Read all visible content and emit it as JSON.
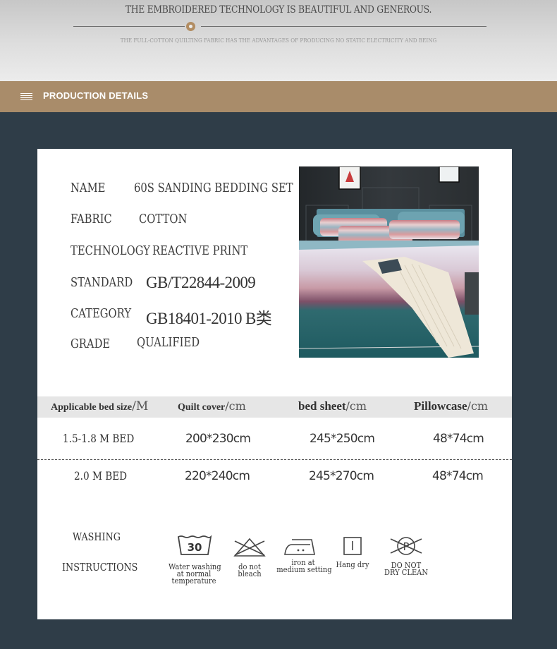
{
  "banner": {
    "title": "THE EMBROIDERED TECHNOLOGY IS BEAUTIFUL AND GENEROUS.",
    "subtitle": "THE FULL-COTTON QUILTING FABRIC HAS THE ADVANTAGES OF PRODUCING NO STATIC ELECTRICITY AND BEING",
    "accent_color": "#b28d62"
  },
  "header": {
    "label": "PRODUCTION DETAILS",
    "icon": "menu-icon",
    "bar_color": "#a98c6a"
  },
  "specs": [
    {
      "label": "NAME",
      "value": "60S SANDING BEDDING SET"
    },
    {
      "label": "FABRIC",
      "value": "COTTON"
    },
    {
      "label": "TECHNOLOGY",
      "value": "REACTIVE PRINT"
    },
    {
      "label": "STANDARD",
      "value": "GB/T22844-2009"
    },
    {
      "label": "CATEGORY",
      "value": "GB18401-2010 B类"
    },
    {
      "label": "GRADE",
      "value": "QUALIFIED"
    }
  ],
  "size_table": {
    "headers": [
      {
        "label": "Applicable bed size",
        "unit": "/M"
      },
      {
        "label": "Quilt cover",
        "unit": "/cm"
      },
      {
        "label": "bed sheet",
        "unit": "/cm"
      },
      {
        "label": "Pillowcase",
        "unit": "/cm"
      }
    ],
    "rows": [
      [
        "1.5-1.8 M BED",
        "200*230cm",
        "245*250cm",
        "48*74cm"
      ],
      [
        "2.0 M BED",
        "220*240cm",
        "245*270cm",
        "48*74cm"
      ]
    ]
  },
  "washing": {
    "label_line1": "WASHING",
    "label_line2": "INSTRUCTIONS",
    "icons": [
      {
        "icon": "wash-30-icon",
        "number": "30",
        "caption": [
          "Water washing",
          "at normal",
          "temperature"
        ]
      },
      {
        "icon": "do-not-bleach-icon",
        "caption": [
          "do not",
          "bleach"
        ]
      },
      {
        "icon": "iron-medium-icon",
        "caption": [
          "iron at",
          "medium setting"
        ]
      },
      {
        "icon": "hang-dry-icon",
        "caption": [
          "Hang dry"
        ]
      },
      {
        "icon": "do-not-dry-clean-icon",
        "letter": "P",
        "caption": [
          "DO NOT",
          "DRY CLEAN"
        ]
      }
    ]
  }
}
